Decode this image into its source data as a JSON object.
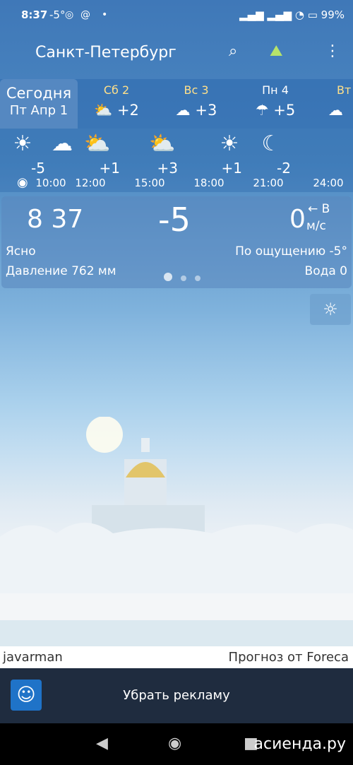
{
  "status": {
    "time": "8:37",
    "temp": "-5°",
    "battery": "99%",
    "icons": [
      "whatsapp-icon",
      "at-icon",
      "signal-icon",
      "wifi-icon",
      "battery-icon"
    ]
  },
  "appbar": {
    "city": "Санкт-Петербург",
    "icons": [
      "search-icon",
      "landscape-icon",
      "more-vert-icon"
    ]
  },
  "days": [
    {
      "name": "Сегодня",
      "sub": "Пт Апр 1",
      "icon": "",
      "temp": ""
    },
    {
      "name": "Сб 2",
      "icon": "partly-cloudy-icon",
      "temp": "+2"
    },
    {
      "name": "Вс 3",
      "icon": "cloud-icon",
      "temp": "+3"
    },
    {
      "name": "Пн 4",
      "icon": "rain-icon",
      "temp": "+5"
    },
    {
      "name": "Вт",
      "icon": "cloud-icon",
      "temp": ""
    }
  ],
  "hours": [
    {
      "icon": "sun-icon",
      "temp": "-5",
      "time": "10:00"
    },
    {
      "icon": "cloud-icon",
      "temp": "+1",
      "time": "12:00"
    },
    {
      "icon": "partly-cloudy-icon",
      "temp": "+3",
      "time": "15:00"
    },
    {
      "icon": "partly-cloudy-icon",
      "temp": "+1",
      "time": "18:00"
    },
    {
      "icon": "sun-icon",
      "temp": "-2",
      "time": "21:00"
    },
    {
      "icon": "moon-icon",
      "temp": "",
      "time": "24:00"
    }
  ],
  "current": {
    "time": "8 37",
    "temp": "-5",
    "wind": "0",
    "wind_dir": "← В",
    "wind_unit": "м/с",
    "condition": "Ясно",
    "feels": "По ощущению -5°",
    "pressure": "Давление 762 мм",
    "water": "Вода 0"
  },
  "credit": {
    "author": "javarman",
    "provider": "Прогноз от Foreca"
  },
  "ad": {
    "label": "Убрать рекламу"
  },
  "watermark": "асиенда.ру"
}
